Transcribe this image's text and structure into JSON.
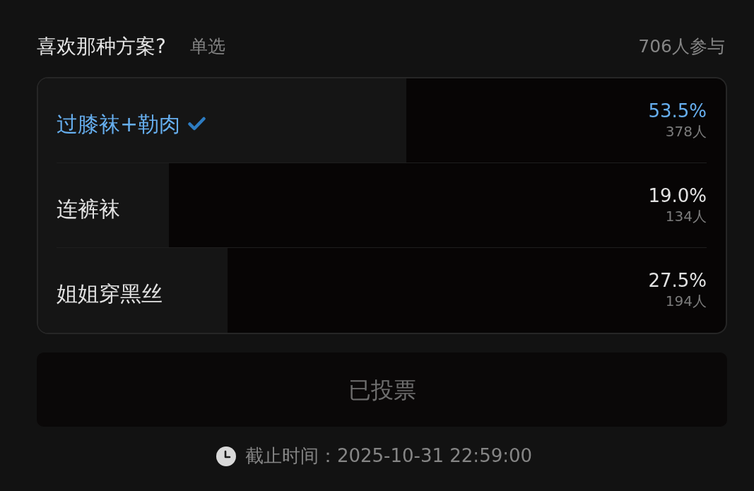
{
  "poll": {
    "question": "喜欢那种方案?",
    "mode": "单选",
    "participants": "706人参与",
    "options": [
      {
        "label": "过膝袜+勒肉",
        "selected": true,
        "level": 0.535,
        "percent": "53.5%",
        "count": "378人"
      },
      {
        "label": "连裤袜",
        "selected": false,
        "level": 0.19,
        "percent": "19.0%",
        "count": "134人"
      },
      {
        "label": "姐姐穿黑丝",
        "selected": false,
        "level": 0.275,
        "percent": "27.5%",
        "count": "194人"
      }
    ],
    "vote_button": {
      "label": "已投票",
      "disabled": true
    },
    "deadline": "截止时间：2025-10-31 22:59:00"
  }
}
